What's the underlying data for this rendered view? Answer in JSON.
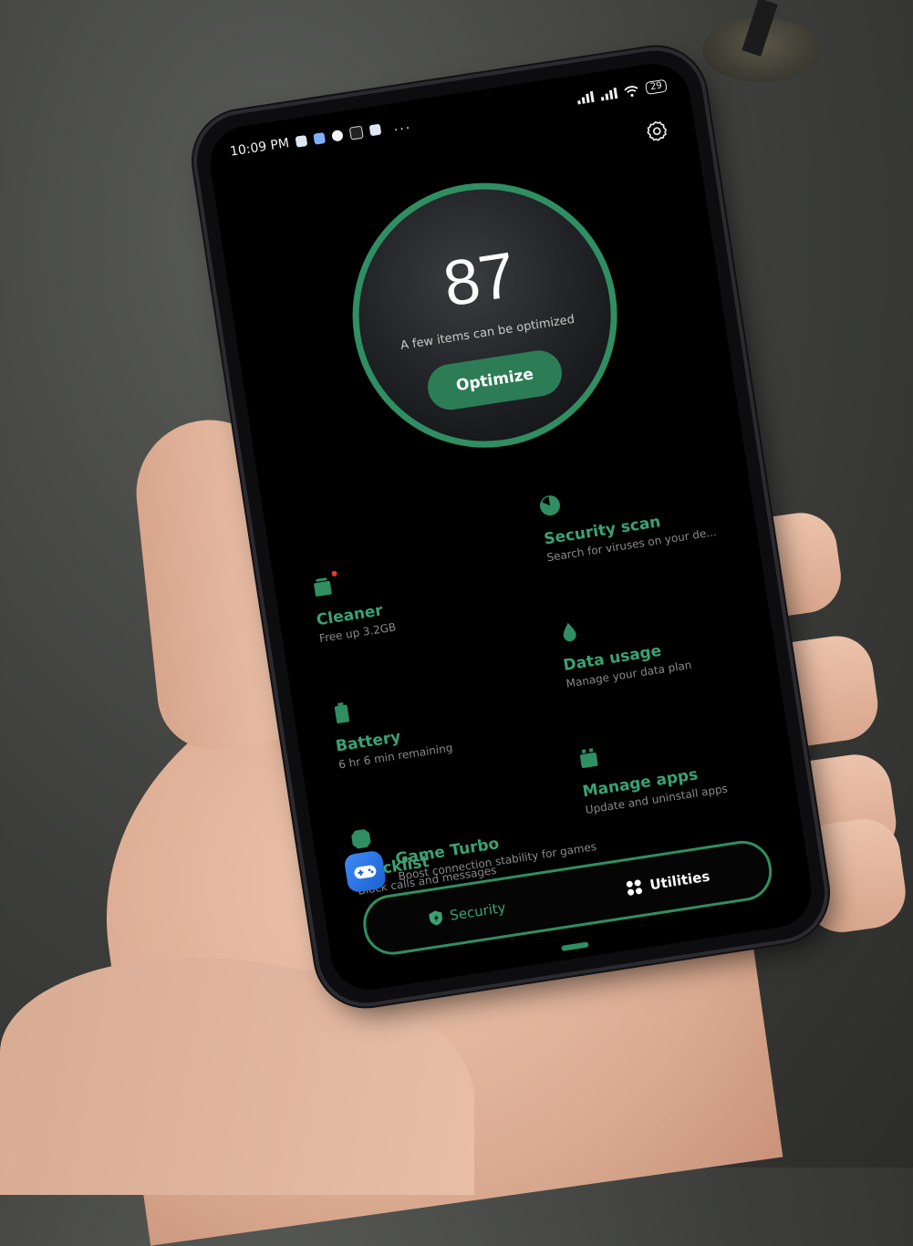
{
  "status_bar": {
    "time": "10:09 PM",
    "overflow": "...",
    "battery": "29"
  },
  "score": {
    "value": "87",
    "subtitle": "A few items can be optimized",
    "button_label": "Optimize"
  },
  "colors": {
    "accent": "#2f8f62",
    "accent_text": "#3aa274",
    "background": "#000000",
    "subtext": "#8a8a8a"
  },
  "tiles": [
    {
      "icon": "security-scan-icon",
      "title": "Security scan",
      "subtitle": "Search for viruses on your de..."
    },
    {
      "icon": "cleaner-icon",
      "title": "Cleaner",
      "subtitle": "Free up 3.2GB",
      "notification_dot": true
    },
    {
      "icon": "data-usage-icon",
      "title": "Data usage",
      "subtitle": "Manage your data plan"
    },
    {
      "icon": "battery-icon",
      "title": "Battery",
      "subtitle": "6 hr 6 min  remaining"
    },
    {
      "icon": "manage-apps-icon",
      "title": "Manage apps",
      "subtitle": "Update and uninstall apps"
    },
    {
      "icon": "blocklist-icon",
      "title": "Blocklist",
      "subtitle": "Block calls and messages"
    }
  ],
  "game_turbo": {
    "icon": "game-controller-icon",
    "title": "Game Turbo",
    "subtitle": "Boost connection stability for games"
  },
  "nav": {
    "security_label": "Security",
    "utilities_label": "Utilities",
    "active": "Utilities"
  }
}
